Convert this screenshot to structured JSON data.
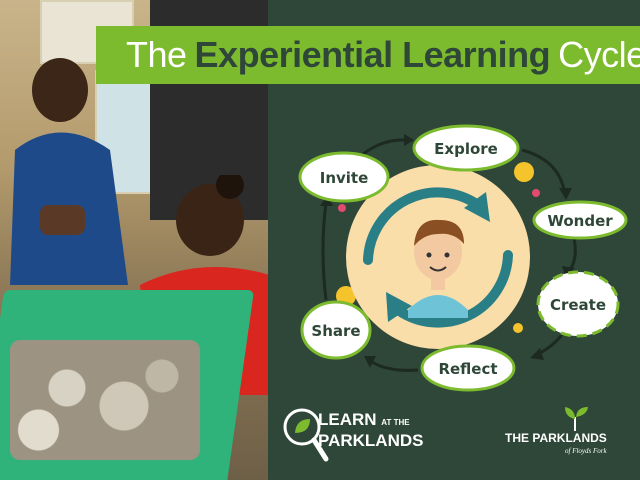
{
  "title": {
    "part1": "The",
    "part2": "Experiential Learning",
    "part3": "Cycle"
  },
  "cycle_steps": [
    "Invite",
    "Explore",
    "Wonder",
    "Create",
    "Reflect",
    "Share"
  ],
  "logos": {
    "learn_line1": "LEARN",
    "learn_small": "AT THE",
    "learn_line2": "PARKLANDS",
    "parklands_main": "THE PARKLANDS",
    "parklands_sub": "of Floyds Fork"
  },
  "colors": {
    "background": "#2f4738",
    "accent_green": "#7dbb2e",
    "center_circle": "#f9deaa",
    "arrow_teal": "#2a7f86"
  }
}
